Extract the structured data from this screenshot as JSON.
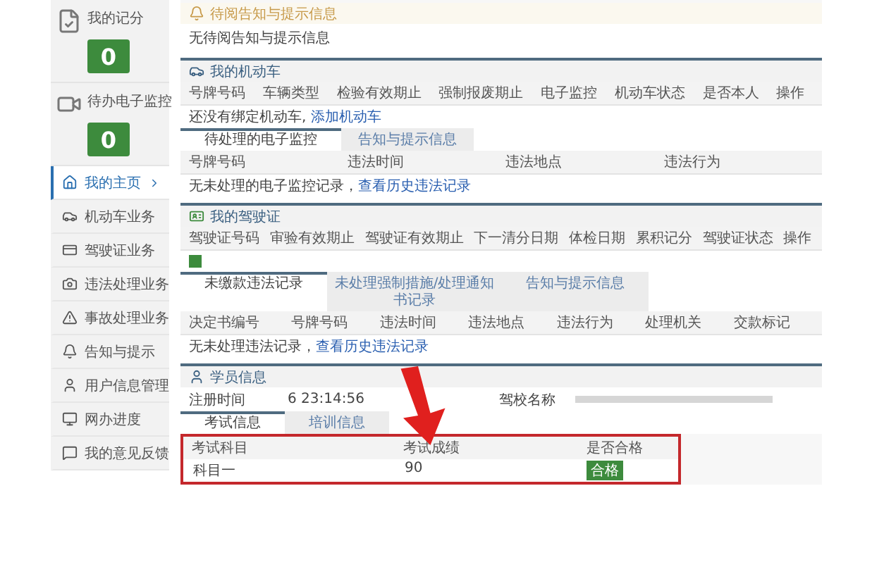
{
  "sidebar": {
    "stats": [
      {
        "kind": "score",
        "label": "我的记分",
        "value": "0"
      },
      {
        "kind": "monitor",
        "label": "待办电子监控",
        "value": "0"
      }
    ],
    "items": [
      {
        "kind": "home",
        "label": "我的主页",
        "selected": true
      },
      {
        "kind": "car",
        "label": "机动车业务",
        "selected": false
      },
      {
        "kind": "license",
        "label": "驾驶证业务",
        "selected": false
      },
      {
        "kind": "camera",
        "label": "违法处理业务",
        "selected": false
      },
      {
        "kind": "warning",
        "label": "事故处理业务",
        "selected": false
      },
      {
        "kind": "bell",
        "label": "告知与提示",
        "selected": false
      },
      {
        "kind": "user",
        "label": "用户信息管理",
        "selected": false
      },
      {
        "kind": "progress",
        "label": "网办进度",
        "selected": false
      },
      {
        "kind": "feedback",
        "label": "我的意见反馈",
        "selected": false
      }
    ]
  },
  "notice": {
    "title": "待阅告知与提示信息",
    "text": "无待阅告知与提示信息"
  },
  "vehicles": {
    "title": "我的机动车",
    "columns": [
      "号牌号码",
      "车辆类型",
      "检验有效期止",
      "强制报废期止",
      "电子监控",
      "机动车状态",
      "是否本人",
      "操作"
    ],
    "empty": {
      "text": "还没有绑定机动车, ",
      "link": "添加机动车"
    },
    "tabs": [
      {
        "label": "待处理的电子监控",
        "selected": true
      },
      {
        "label": "告知与提示信息",
        "selected": false
      }
    ],
    "tab_columns": [
      "号牌号码",
      "违法时间",
      "违法地点",
      "违法行为"
    ],
    "tab_empty": {
      "text": "无未处理的电子监控记录，",
      "link": "查看历史违法记录"
    }
  },
  "license": {
    "title": "我的驾驶证",
    "columns": [
      "驾驶证号码",
      "审验有效期止",
      "驾驶证有效期止",
      "下一清分日期",
      "体检日期",
      "累积记分",
      "驾驶证状态",
      "操作"
    ],
    "tabs": [
      {
        "label": "未缴款违法记录",
        "selected": true
      },
      {
        "label": "未处理强制措施/处理通知书记录",
        "selected": false
      },
      {
        "label": "告知与提示信息",
        "selected": false
      }
    ],
    "tab_columns": [
      "决定书编号",
      "号牌号码",
      "违法时间",
      "违法地点",
      "违法行为",
      "处理机关",
      "交款标记"
    ],
    "tab_empty": {
      "text": "无未处理违法记录，",
      "link": "查看历史违法记录"
    }
  },
  "student": {
    "title": "学员信息",
    "reg_label": "注册时间",
    "reg_value": "6 23:14:56",
    "school_label": "驾校名称",
    "tabs": [
      {
        "label": "考试信息",
        "selected": true
      },
      {
        "label": "培训信息",
        "selected": false
      }
    ],
    "exam": {
      "highlighted": true,
      "columns": [
        "考试科目",
        "考试成绩",
        "是否合格"
      ],
      "rows": [
        {
          "subject": "科目一",
          "score": "90",
          "result": "合格",
          "passed": true
        }
      ]
    }
  }
}
